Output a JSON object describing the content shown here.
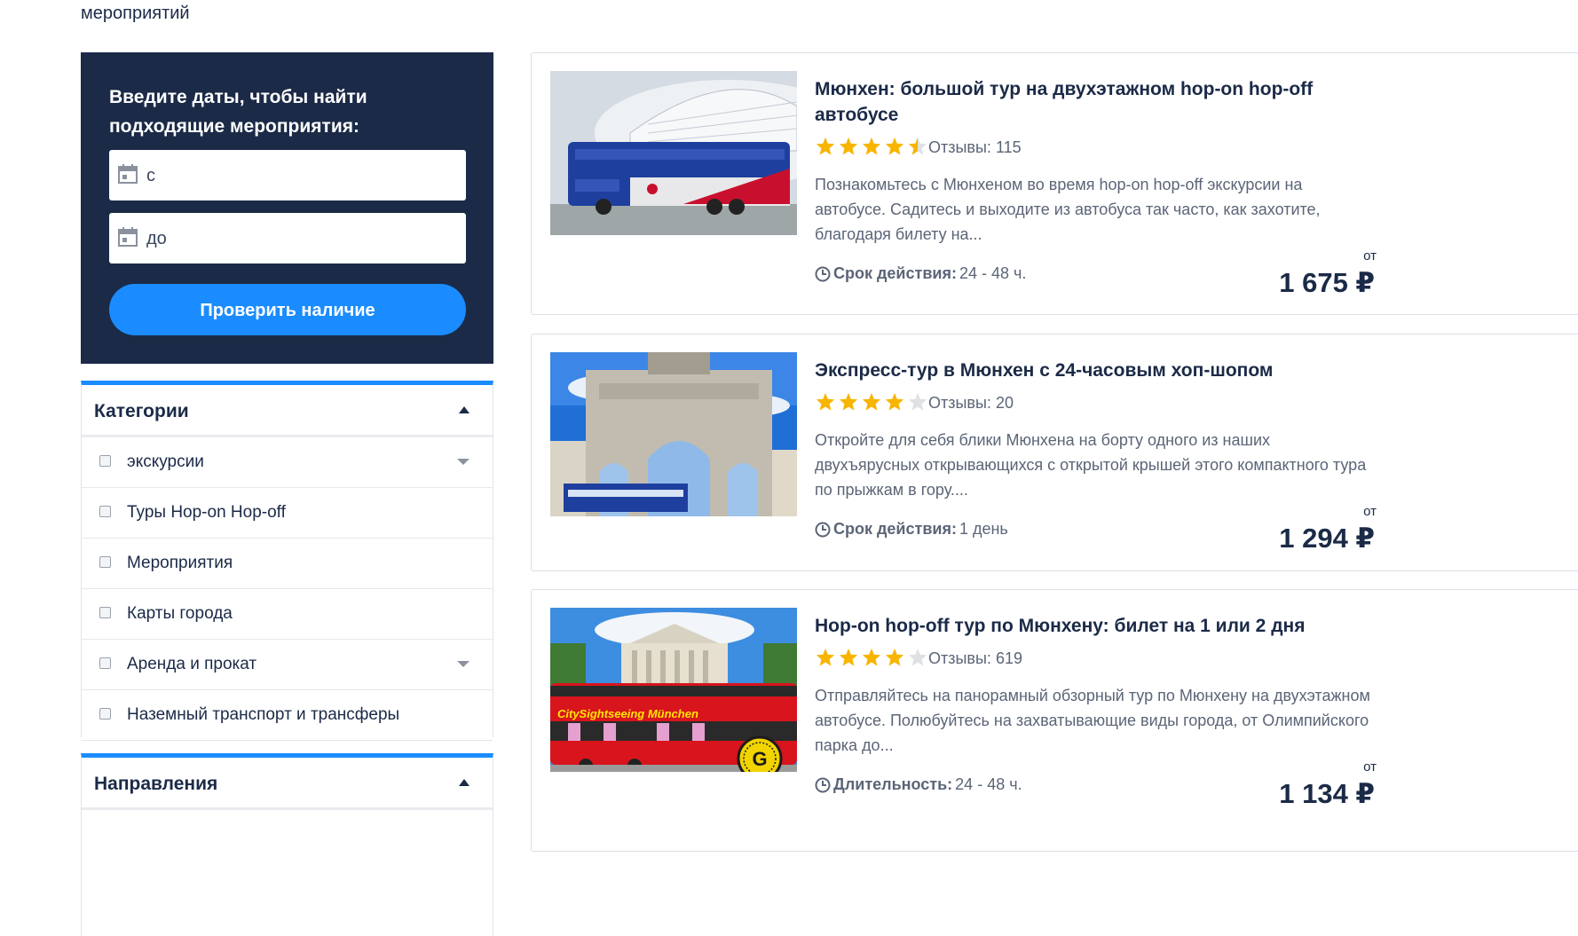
{
  "breadcrumb": {
    "text": "мероприятий"
  },
  "date_panel": {
    "title": "Введите даты, чтобы найти подходящие мероприятия:",
    "from_placeholder": "с",
    "to_placeholder": "до",
    "check_button": "Проверить наличие"
  },
  "categories": {
    "title": "Категории",
    "items": [
      {
        "label": "экскурсии",
        "expandable": true
      },
      {
        "label": "Туры Hop-on Hop-off",
        "expandable": false
      },
      {
        "label": "Мероприятия",
        "expandable": false
      },
      {
        "label": "Карты города",
        "expandable": false
      },
      {
        "label": "Аренда и прокат",
        "expandable": true
      },
      {
        "label": "Наземный транспорт и трансферы",
        "expandable": false
      }
    ]
  },
  "directions": {
    "title": "Направления"
  },
  "products": [
    {
      "title": "Мюнхен: большой тур на двухэтажном hop-on hop-off автобусе",
      "rating": 4.5,
      "reviews": "Отзывы: 115",
      "description": "Познакомьтесь с Мюнхеном во время hop-on hop-off экскурсии на автобусе. Садитесь и выходите из автобуса так часто, как захотите, благодаря билету на...",
      "duration_label": "Срок действия:",
      "duration_value": "24 - 48 ч.",
      "price_prefix": "от",
      "price": "1 675 ₽",
      "image_alt": "bus-allianz-arena"
    },
    {
      "title": "Экспресс-тур в Мюнхен с 24-часовым хоп-шопом",
      "rating": 4,
      "reviews": "Отзывы: 20",
      "description": "Откройте для себя блики Мюнхена на борту одного из наших двухъярусных открывающихся с открытой крышей этого компактного тура по прыжкам в гору....",
      "duration_label": "Срок действия:",
      "duration_value": "1 день",
      "price_prefix": "от",
      "price": "1 294 ₽",
      "image_alt": "siegestor-arch"
    },
    {
      "title": "Hop-on hop-off тур по Мюнхену: билет на 1 или 2 дня",
      "rating": 4,
      "reviews": "Отзывы: 619",
      "description": "Отправляйтесь на панорамный обзорный тур по Мюнхену на двухэтажном автобусе. Полюбуйтесь на захватывающие виды города, от Олимпийского парка до...",
      "duration_label": "Длительность:",
      "duration_value": "24 - 48 ч.",
      "price_prefix": "от",
      "price": "1 134 ₽",
      "image_alt": "citysightseeing-bus",
      "image_text": "CitySightseeing München",
      "badge": "G"
    }
  ],
  "colors": {
    "navy": "#1b2a47",
    "accent": "#1a8cff",
    "star": "#f7b500"
  }
}
